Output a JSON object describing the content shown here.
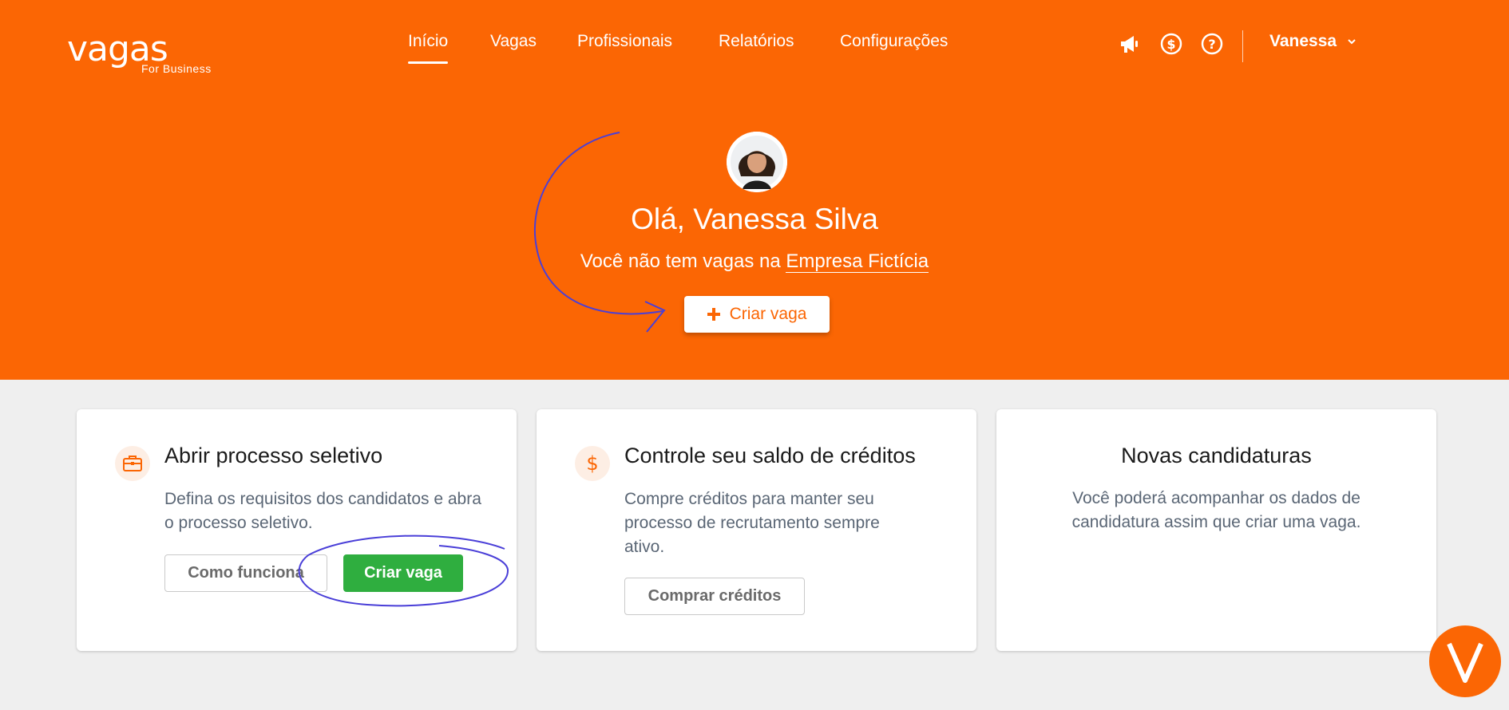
{
  "colors": {
    "brand": "#fb6604",
    "green": "#2fae3f",
    "annotation": "#4a3fd8",
    "background": "#efefef"
  },
  "logo": {
    "main": "vagas",
    "sub": "For Business"
  },
  "nav": {
    "items": [
      {
        "label": "Início",
        "active": true
      },
      {
        "label": "Vagas",
        "active": false
      },
      {
        "label": "Profissionais",
        "active": false
      },
      {
        "label": "Relatórios",
        "active": false
      },
      {
        "label": "Configurações",
        "active": false
      }
    ]
  },
  "header_icons": [
    "megaphone-icon",
    "dollar-circle-icon",
    "help-circle-icon"
  ],
  "user": {
    "name": "Vanessa",
    "chevron_icon": "chevron-down-icon"
  },
  "hero": {
    "greeting": "Olá, Vanessa Silva",
    "subtitle_prefix": "Você não tem vagas na ",
    "company_link": "Empresa Fictícia",
    "button_label": "Criar vaga",
    "button_icon": "plus-icon"
  },
  "cards": [
    {
      "icon": "briefcase-icon",
      "title": "Abrir processo seletivo",
      "text": "Defina os requisitos dos candidatos e abra o processo seletivo.",
      "secondary_button": "Como funciona",
      "primary_button": "Criar vaga"
    },
    {
      "icon": "dollar-icon",
      "title": "Controle seu saldo de créditos",
      "text": "Compre créditos para manter seu processo de recrutamento sempre ativo.",
      "secondary_button": "Comprar créditos"
    },
    {
      "title": "Novas candidaturas",
      "text": "Você poderá acompanhar os dados de candidatura assim que criar uma vaga."
    }
  ],
  "fab": {
    "icon": "vagas-v-icon"
  }
}
